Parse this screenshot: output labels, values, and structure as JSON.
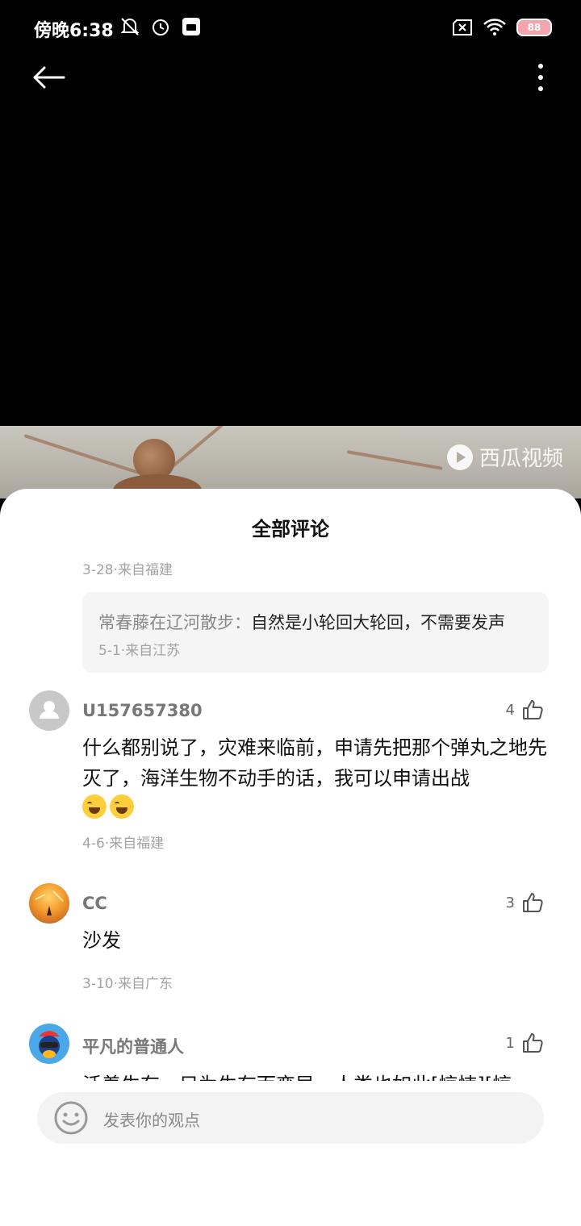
{
  "status_bar": {
    "time": "傍晚6:38",
    "battery": "88",
    "icons_left": [
      "bell-off-icon",
      "alarm-icon",
      "mi-app-icon"
    ],
    "icons_right": [
      "sim-x-icon",
      "wifi-icon",
      "battery-icon"
    ]
  },
  "video": {
    "watermark": "西瓜视频"
  },
  "comments_panel": {
    "title": "全部评论",
    "top_meta": "3-28·来自福建",
    "reply": {
      "author": "常春藤在辽河散步：",
      "text": "自然是小轮回大轮回，不需要发声",
      "meta": "5-1·来自江苏"
    },
    "comments": [
      {
        "username": "U157657380",
        "likes": "4",
        "text": "什么都别说了，灾难来临前，申请先把那个弹丸之地先灭了，海洋生物不动手的话，我可以申请出战",
        "meta": "4-6·来自福建"
      },
      {
        "username": "CC",
        "likes": "3",
        "text": "沙发",
        "meta": "3-10·来自广东"
      },
      {
        "username": "平凡的普通人",
        "likes": "1",
        "text": "活着生存，只为生存而变异，人类也如此[惊悚][惊"
      }
    ]
  },
  "input": {
    "placeholder": "发表你的观点"
  },
  "colors": {
    "background": "#000000",
    "sheet": "#ffffff",
    "input_bg": "#f3f3f3"
  }
}
